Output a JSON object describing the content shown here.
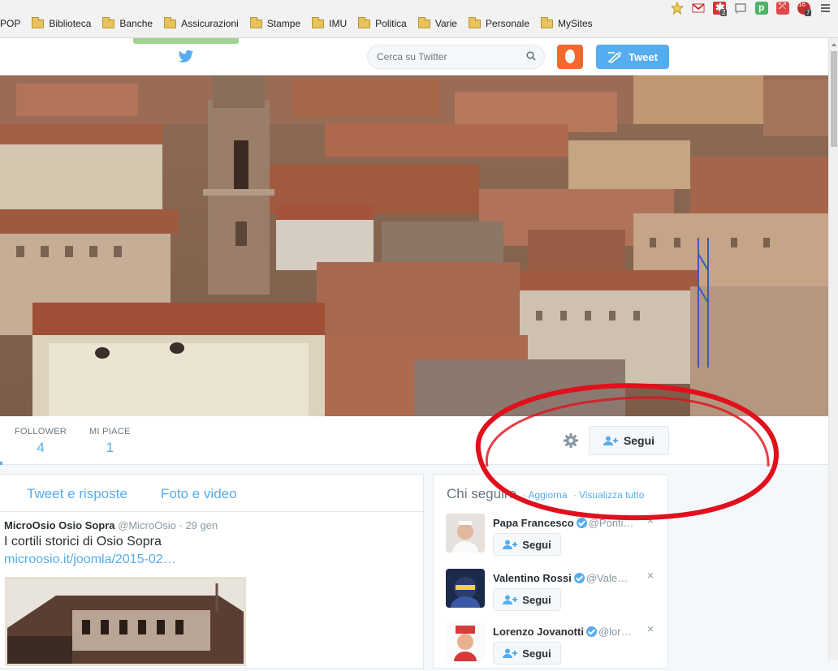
{
  "bookmarks": {
    "first_partial": "POP",
    "folders": [
      "Biblioteca",
      "Banche",
      "Assicurazioni",
      "Stampe",
      "IMU",
      "Politica",
      "Varie",
      "Personale",
      "MySites"
    ]
  },
  "extensions": {
    "badge_1": "2",
    "badge_2": "16",
    "badge_3": "7"
  },
  "topbar": {
    "search_placeholder": "Cerca su Twitter",
    "tweet_button": "Tweet"
  },
  "profile_nav": {
    "followers_label": "FOLLOWER",
    "followers_value": "4",
    "likes_label": "MI PIACE",
    "likes_value": "1",
    "follow_button": "Segui"
  },
  "timeline": {
    "tab_tweets": "Tweet e risposte",
    "tab_media": "Foto e video",
    "tweet": {
      "name": "MicroOsio Osio Sopra",
      "handle": "@MicroOsio",
      "separator": "·",
      "date": "29 gen",
      "text": "I cortili storici di Osio Sopra",
      "link": "microosio.it/joomla/2015-02…"
    }
  },
  "who_to_follow": {
    "title": "Chi seguire",
    "dot": "·",
    "refresh": "Aggiorna",
    "view_all": "Visualizza tutto",
    "follow_label": "Segui",
    "close": "×",
    "suggestions": [
      {
        "name": "Papa Francesco",
        "handle": "@Ponti…"
      },
      {
        "name": "Valentino Rossi",
        "handle": "@Vale…"
      },
      {
        "name": "Lorenzo Jovanotti",
        "handle": "@lor…"
      }
    ]
  },
  "colors": {
    "twitter_blue": "#55acee",
    "annotation_red": "#e0101c",
    "avatar_orange": "#ef6a2c"
  }
}
